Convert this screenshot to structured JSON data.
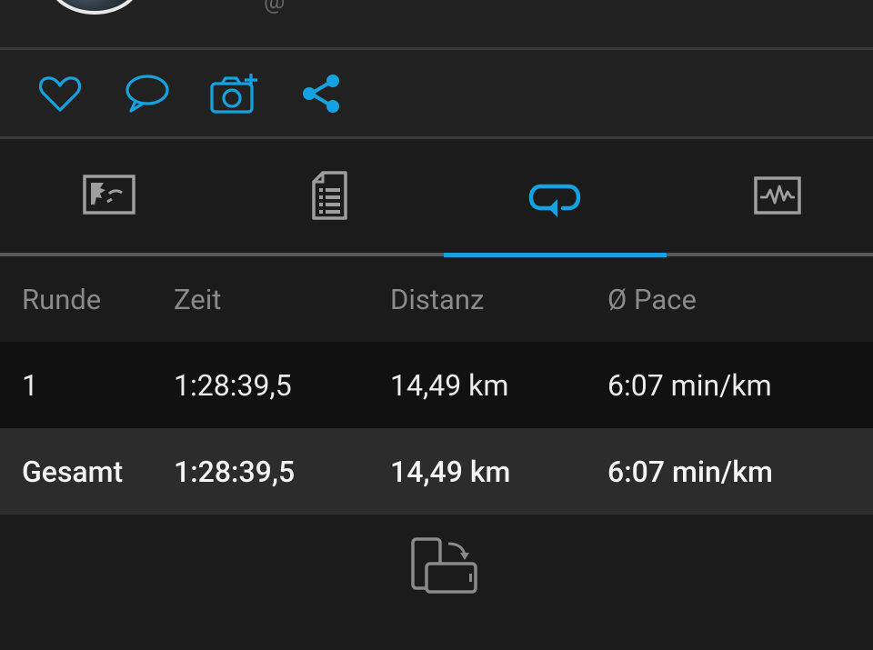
{
  "profile": {
    "mention_symbol": "@"
  },
  "actions": [
    {
      "name": "like",
      "icon": "heart-icon"
    },
    {
      "name": "comment",
      "icon": "speech-bubble-icon"
    },
    {
      "name": "add-photo",
      "icon": "camera-plus-icon"
    },
    {
      "name": "share",
      "icon": "share-icon"
    }
  ],
  "tabs": [
    {
      "name": "map",
      "icon": "map-icon",
      "active": false
    },
    {
      "name": "details",
      "icon": "document-list-icon",
      "active": false
    },
    {
      "name": "laps",
      "icon": "lap-loop-icon",
      "active": true
    },
    {
      "name": "charts",
      "icon": "chart-pulse-icon",
      "active": false
    }
  ],
  "laps_table": {
    "headers": [
      "Runde",
      "Zeit",
      "Distanz",
      "Ø Pace"
    ],
    "rows": [
      [
        "1",
        "1:28:39,5",
        "14,49 km",
        "6:07 min/km"
      ]
    ],
    "total": [
      "Gesamt",
      "1:28:39,5",
      "14,49 km",
      "6:07 min/km"
    ]
  },
  "footer": {
    "icon": "rotate-screen-icon"
  },
  "colors": {
    "accent": "#14a3e0",
    "background": "#1b1b1b",
    "panel": "#212121",
    "row_lap": "#111111",
    "row_total": "#2c2c2c",
    "icon_gray": "#9e9e9e"
  }
}
